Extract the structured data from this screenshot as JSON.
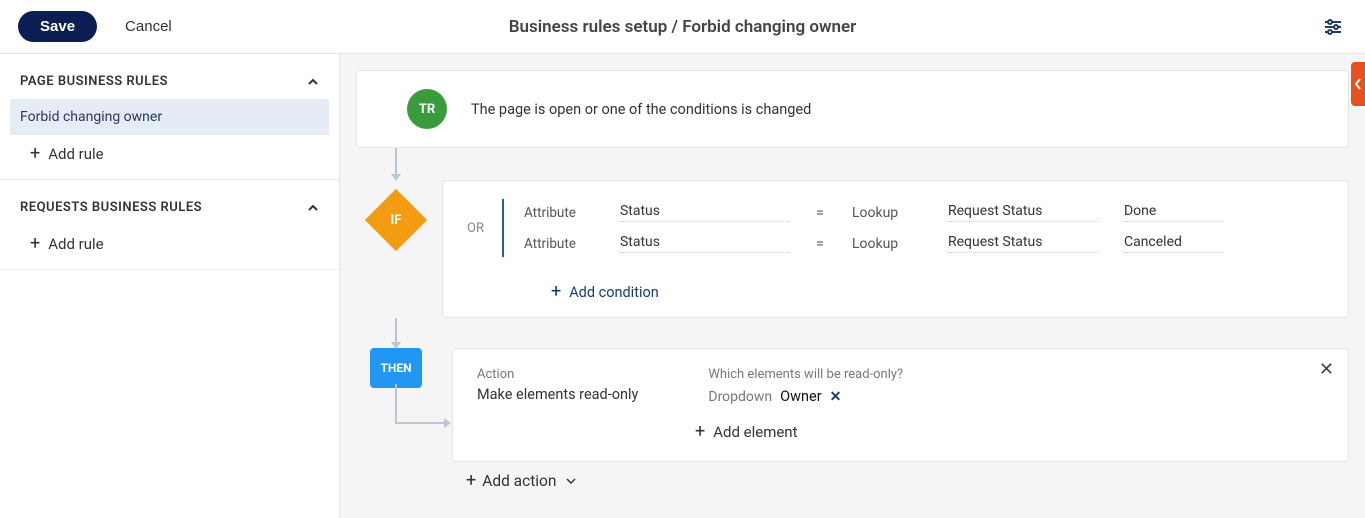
{
  "topbar": {
    "save": "Save",
    "cancel": "Cancel",
    "breadcrumb": "Business rules setup / Forbid changing owner"
  },
  "sidebar": {
    "sections": [
      {
        "title": "PAGE BUSINESS RULES",
        "items": [
          {
            "label": "Forbid changing owner",
            "active": true
          }
        ],
        "add": "Add rule"
      },
      {
        "title": "REQUESTS BUSINESS RULES",
        "items": [],
        "add": "Add rule"
      }
    ]
  },
  "flow": {
    "tr": {
      "badge": "TR",
      "text": "The page is open or one of the conditions is changed"
    },
    "if": {
      "badge": "IF",
      "or": "OR",
      "rows": [
        {
          "kind": "Attribute",
          "attr": "Status",
          "op": "=",
          "type": "Lookup",
          "lookup": "Request Status",
          "value": "Done"
        },
        {
          "kind": "Attribute",
          "attr": "Status",
          "op": "=",
          "type": "Lookup",
          "lookup": "Request Status",
          "value": "Canceled"
        }
      ],
      "add": "Add condition"
    },
    "then": {
      "badge": "THEN",
      "actionLabel": "Action",
      "actionValue": "Make elements read-only",
      "elementsLabel": "Which elements will be read-only?",
      "elementType": "Dropdown",
      "elementName": "Owner",
      "addElement": "Add element",
      "addAction": "Add action"
    }
  }
}
